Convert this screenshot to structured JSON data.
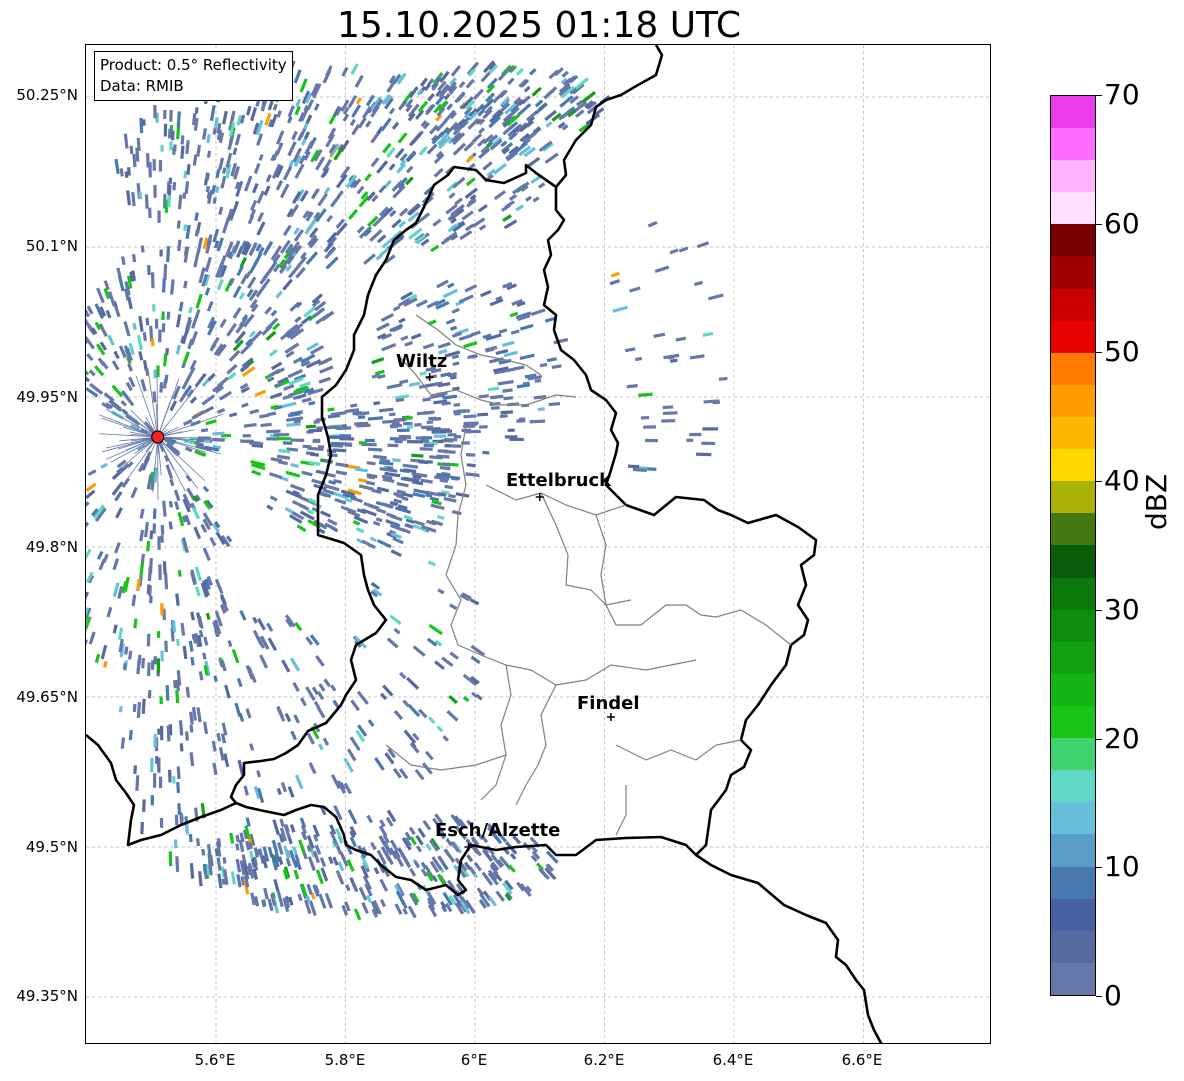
{
  "title": "15.10.2025 01:18 UTC",
  "info": {
    "product": "Product: 0.5° Reflectivity",
    "source": "Data: RMIB"
  },
  "axes": {
    "lat_labels": [
      "50.25°N",
      "50.1°N",
      "49.95°N",
      "49.8°N",
      "49.65°N",
      "49.5°N",
      "49.35°N"
    ],
    "lon_labels": [
      "5.6°E",
      "5.8°E",
      "6°E",
      "6.2°E",
      "6.4°E",
      "6.6°E"
    ],
    "grid": true
  },
  "cities": [
    {
      "name": "Wiltz",
      "lon": 5.93,
      "lat": 49.97
    },
    {
      "name": "Ettelbruck",
      "lon": 6.1,
      "lat": 49.85
    },
    {
      "name": "Findel",
      "lon": 6.21,
      "lat": 49.63
    },
    {
      "name": "Esch/Alzette",
      "lon": 5.99,
      "lat": 49.5
    }
  ],
  "radar_site": {
    "lon": 5.51,
    "lat": 49.91,
    "color": "#ff2020"
  },
  "colorbar": {
    "label": "dBZ",
    "min": 0,
    "max": 70,
    "ticks": [
      "0",
      "10",
      "20",
      "30",
      "40",
      "50",
      "60",
      "70"
    ],
    "colors": [
      "#6677aa",
      "#566aa0",
      "#4660a0",
      "#4a78b0",
      "#5a9ec8",
      "#66c0dc",
      "#60d6c4",
      "#40d470",
      "#18c418",
      "#14b414",
      "#10a010",
      "#0e8c0e",
      "#0c780c",
      "#0a5c0a",
      "#447810",
      "#aab208",
      "#ffd800",
      "#ffb800",
      "#ff9c00",
      "#ff7c00",
      "#e80000",
      "#c80000",
      "#a00000",
      "#780000",
      "#ffe0ff",
      "#ffb4ff",
      "#ff6cff",
      "#ea3cea"
    ]
  }
}
